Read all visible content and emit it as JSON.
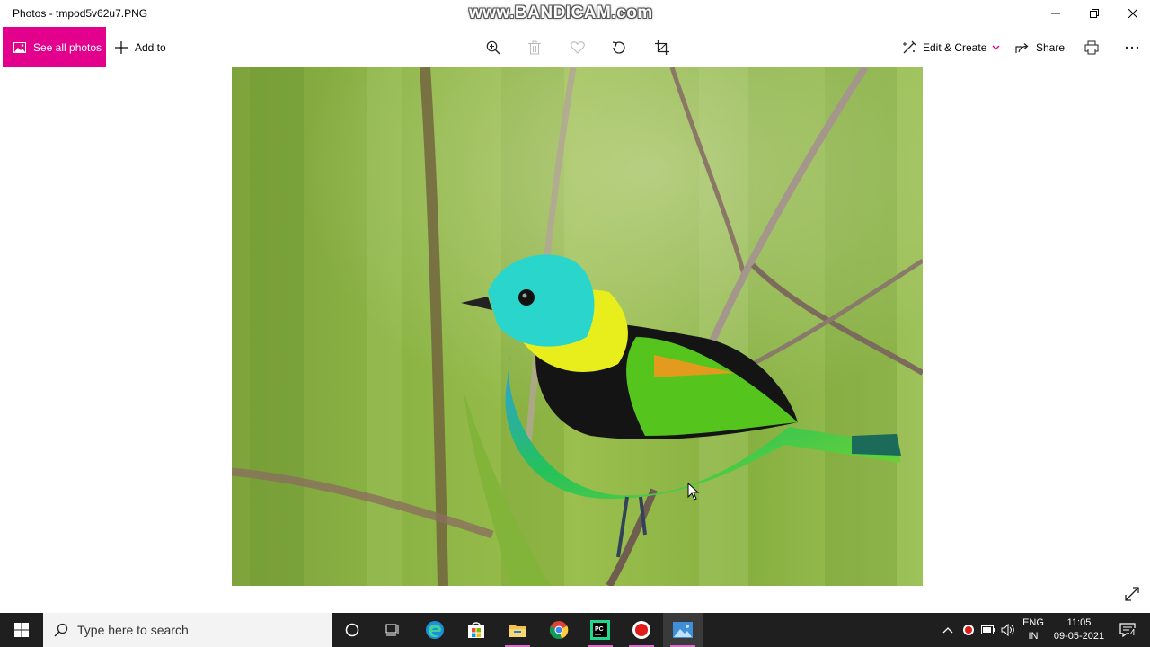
{
  "window": {
    "title": "Photos - tmpod5v62u7.PNG",
    "watermark": "www.BANDICAM.com"
  },
  "toolbar": {
    "see_all_photos": "See all photos",
    "add_to": "Add to",
    "edit_create": "Edit & Create",
    "share": "Share",
    "accent_color": "#e3008c",
    "icons": [
      "zoom-icon",
      "delete-icon",
      "favorite-icon",
      "rotate-icon",
      "crop-icon",
      "print-icon",
      "more-icon"
    ]
  },
  "photo": {
    "subject": "bird"
  },
  "taskbar": {
    "search_placeholder": "Type here to search",
    "apps": [
      "cortana",
      "task-view",
      "edge",
      "store",
      "file-explorer",
      "chrome",
      "pycharm",
      "bandicam",
      "photos"
    ],
    "language_top": "ENG",
    "language_bottom": "IN",
    "time": "11:05",
    "date": "09-05-2021",
    "notification_count": "4"
  }
}
